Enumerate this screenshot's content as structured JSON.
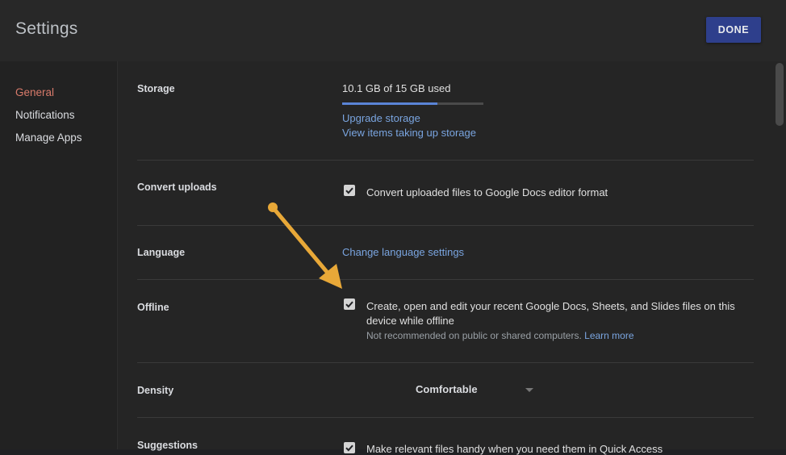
{
  "header": {
    "title": "Settings",
    "done_label": "DONE"
  },
  "sidebar": {
    "items": [
      {
        "label": "General",
        "active": true
      },
      {
        "label": "Notifications",
        "active": false
      },
      {
        "label": "Manage Apps",
        "active": false
      }
    ]
  },
  "storage": {
    "label": "Storage",
    "usage_text": "10.1 GB of 15 GB used",
    "used_fraction": 0.673,
    "upgrade_link": "Upgrade storage",
    "view_items_link": "View items taking up storage"
  },
  "convert_uploads": {
    "label": "Convert uploads",
    "checked": true,
    "option_text": "Convert uploaded files to Google Docs editor format"
  },
  "language": {
    "label": "Language",
    "link": "Change language settings"
  },
  "offline": {
    "label": "Offline",
    "checked": true,
    "option_text_line1": "Create, open and edit your recent Google Docs, Sheets, and Slides files on this",
    "option_text_line2": "device while offline",
    "note": "Not recommended on public or shared computers.",
    "learn_more": "Learn more"
  },
  "density": {
    "label": "Density",
    "selected": "Comfortable"
  },
  "suggestions": {
    "label": "Suggestions",
    "checked": true,
    "option_text": "Make relevant files handy when you need them in Quick Access"
  },
  "colors": {
    "accent": "#2e3f8c",
    "active_nav": "#d97b6b",
    "link": "#7aa5e0",
    "annotation_arrow": "#e8a838"
  }
}
